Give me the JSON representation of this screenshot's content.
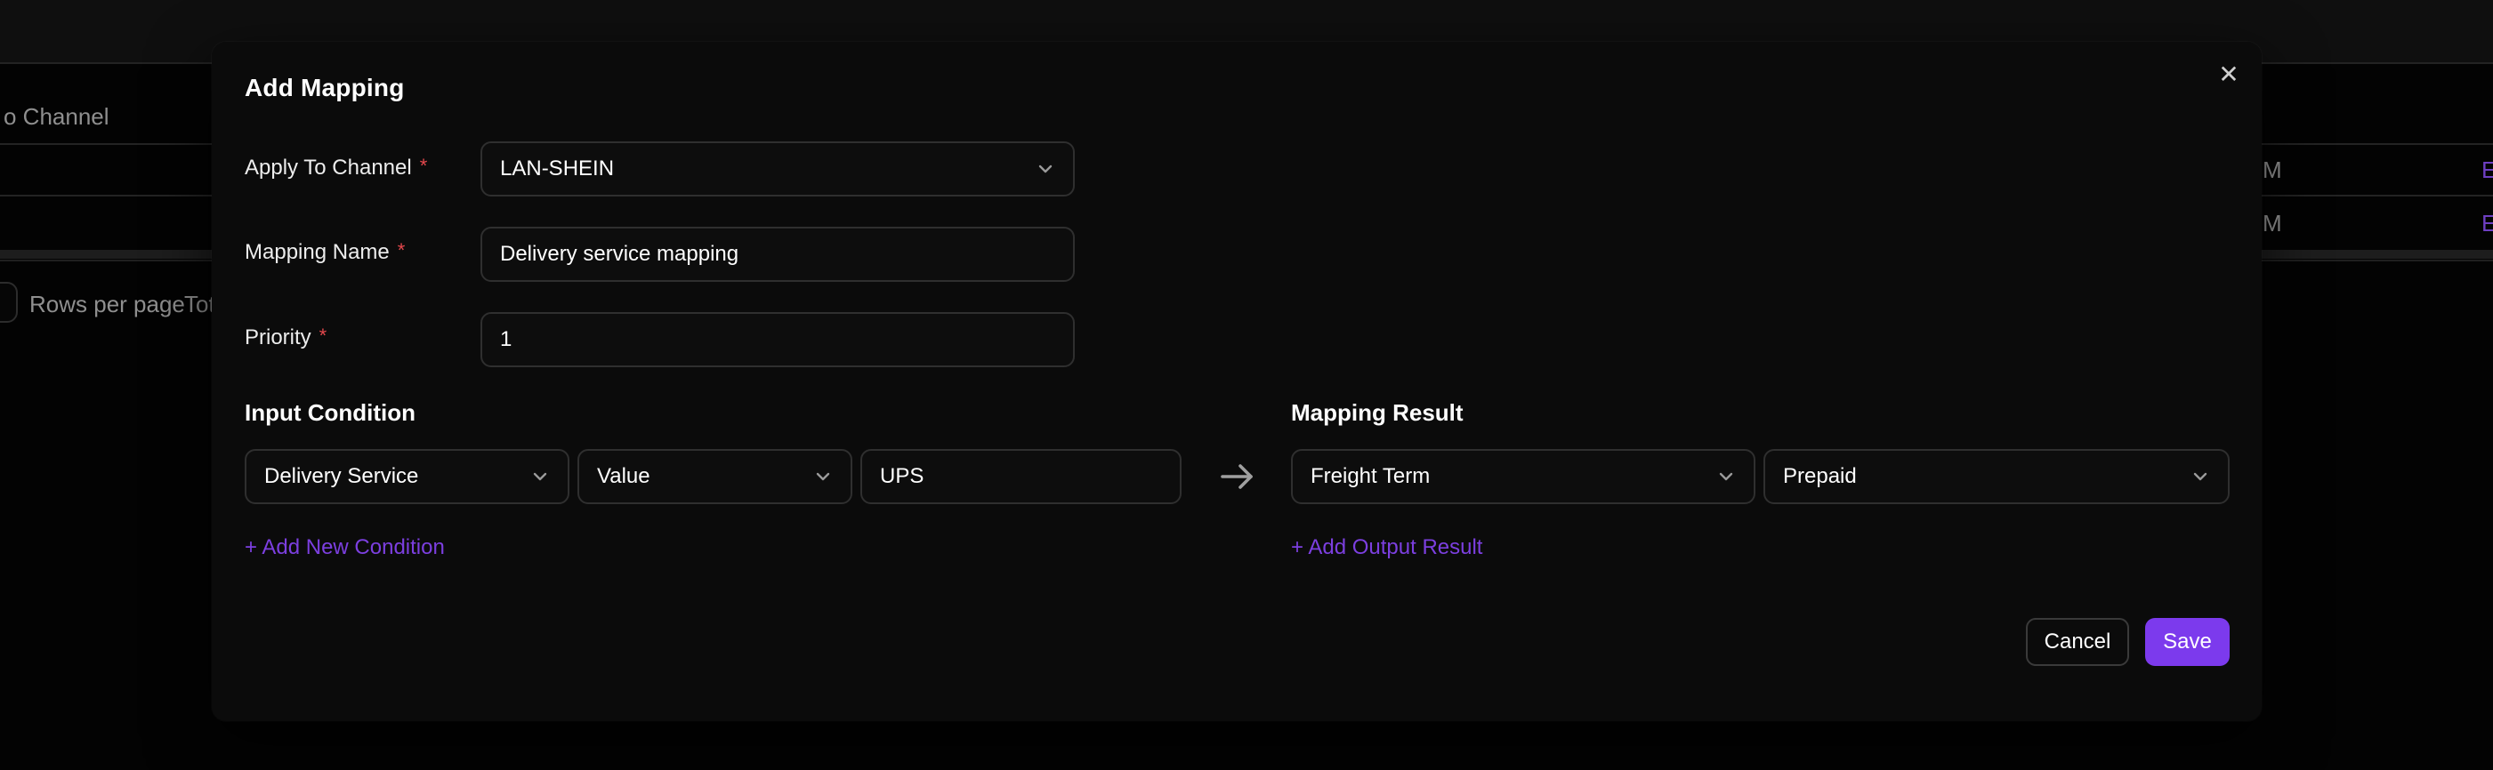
{
  "background": {
    "header_cell_fragment": "o Channel",
    "rows": [
      {
        "time_fragment": "M",
        "action_fragment": "E"
      },
      {
        "time_fragment": "M",
        "action_fragment": "E"
      }
    ],
    "footer": {
      "rows_per_page_label": "Rows per page",
      "total_fragment": "Tot"
    }
  },
  "modal": {
    "title": "Add Mapping",
    "close_glyph": "✕",
    "required_marker": "*",
    "fields": [
      {
        "label": "Apply To Channel",
        "value": "LAN-SHEIN"
      },
      {
        "label": "Mapping Name",
        "value": "Delivery service mapping"
      },
      {
        "label": "Priority",
        "value": "1"
      }
    ],
    "input_condition": {
      "heading": "Input Condition",
      "field_select_value": "Delivery Service",
      "operator_select_value": "Value",
      "value_input": "UPS",
      "add_link": "+ Add New Condition"
    },
    "mapping_result": {
      "heading": "Mapping Result",
      "field_select_value": "Freight Term",
      "value_select_value": "Prepaid",
      "add_link": "+ Add Output Result"
    },
    "buttons": {
      "cancel": "Cancel",
      "save": "Save"
    }
  },
  "colors": {
    "accent_purple": "#7c3aed",
    "link_purple": "#7c3fe0",
    "required_red": "#e5484d",
    "muted_text": "#8f8f8f"
  }
}
